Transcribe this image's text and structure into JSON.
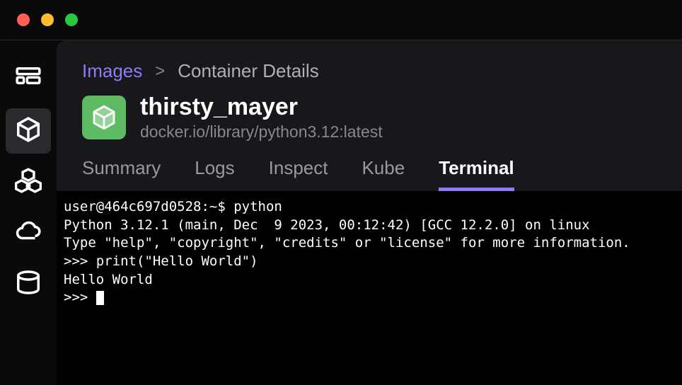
{
  "breadcrumb": {
    "link": "Images",
    "separator": ">",
    "current": "Container Details"
  },
  "container": {
    "name": "thirsty_mayer",
    "image": "docker.io/library/python3.12:latest"
  },
  "tabs": {
    "summary": "Summary",
    "logs": "Logs",
    "inspect": "Inspect",
    "kube": "Kube",
    "terminal": "Terminal"
  },
  "terminal": {
    "line1": "user@464c697d0528:~$ python",
    "line2": "Python 3.12.1 (main, Dec  9 2023, 00:12:42) [GCC 12.2.0] on linux",
    "line3": "Type \"help\", \"copyright\", \"credits\" or \"license\" for more information.",
    "line4": ">>> print(\"Hello World\")",
    "line5": "Hello World",
    "line6": ">>> "
  }
}
